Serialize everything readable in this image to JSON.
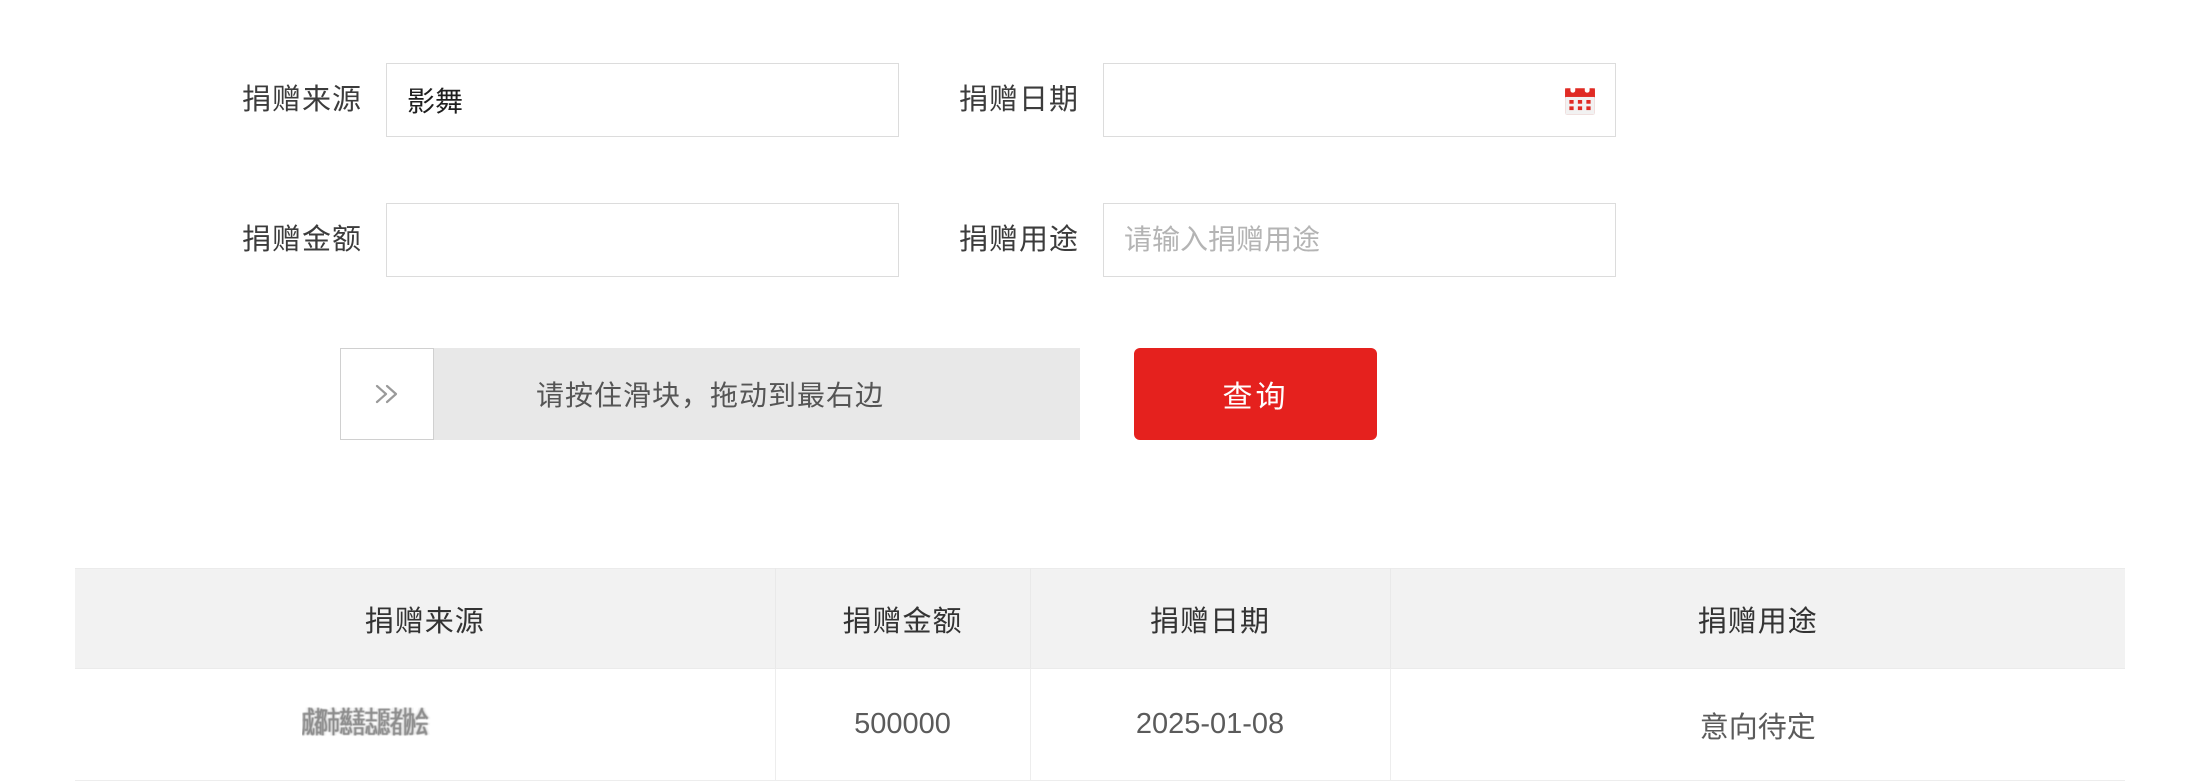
{
  "form": {
    "fields": [
      {
        "key": "donation_source",
        "label": "捐赠来源",
        "value": "影舞",
        "placeholder": ""
      },
      {
        "key": "donation_date",
        "label": "捐赠日期",
        "value": "",
        "placeholder": "",
        "icon": "calendar-icon"
      },
      {
        "key": "donation_amount",
        "label": "捐赠金额",
        "value": "",
        "placeholder": ""
      },
      {
        "key": "donation_purpose",
        "label": "捐赠用途",
        "value": "",
        "placeholder": "请输入捐赠用途"
      }
    ],
    "slider_captcha": {
      "tip": "请按住滑块，拖动到最右边",
      "handle_icon": "double-chevron-right-icon",
      "track_color": "#e8e8e8"
    },
    "submit_button": {
      "label": "查询",
      "color": "#e5211e"
    }
  },
  "table": {
    "headers": [
      "捐赠来源",
      "捐赠金额",
      "捐赠日期",
      "捐赠用途"
    ],
    "header_bg": "#f2f2f2",
    "rows": [
      {
        "source": "成都市慈善志愿者协会",
        "source_redacted": true,
        "amount": "500000",
        "date": "2025-01-08",
        "purpose": "意向待定"
      }
    ]
  }
}
